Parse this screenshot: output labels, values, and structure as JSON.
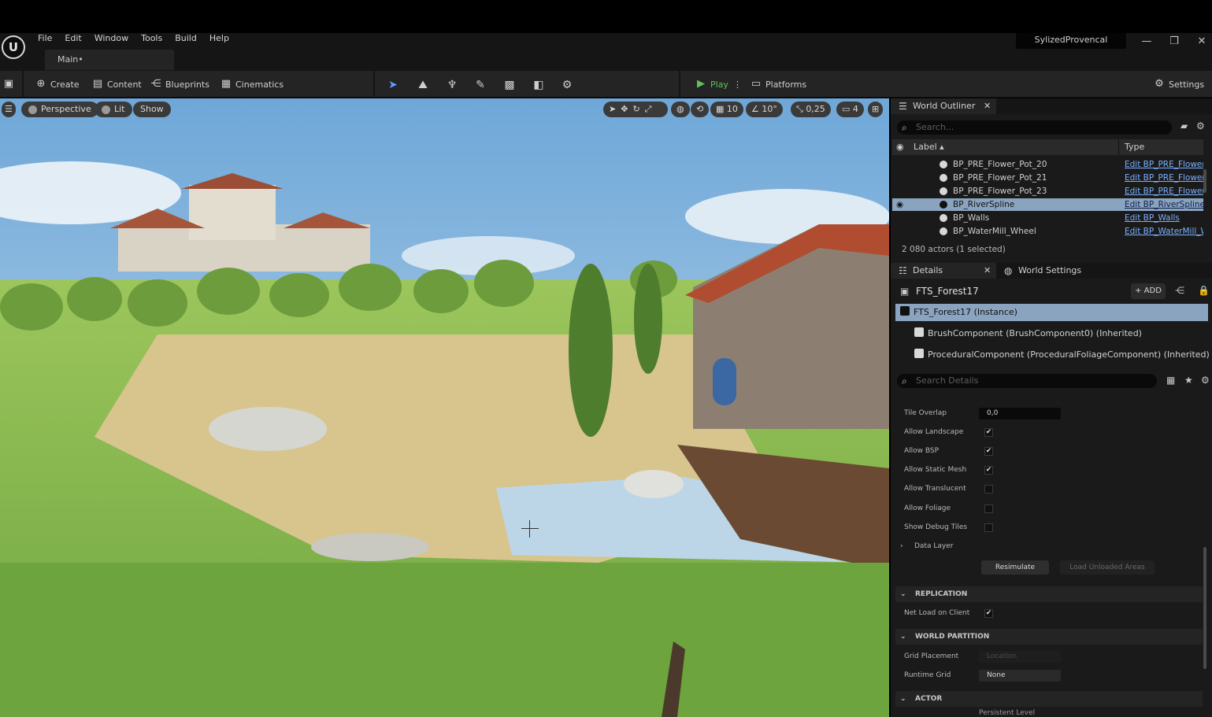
{
  "app": {
    "logo": "U",
    "menu": [
      "File",
      "Edit",
      "Window",
      "Tools",
      "Build",
      "Help"
    ],
    "document_tab": "Main•",
    "project_name": "SylizedProvencal",
    "window_controls": {
      "minimize": "—",
      "maximize": "❐",
      "close": "✕"
    }
  },
  "toolbar": {
    "create": "Create",
    "content": "Content",
    "blueprints": "Blueprints",
    "cinematics": "Cinematics",
    "play": "Play",
    "platforms": "Platforms",
    "settings": "Settings",
    "mode_icons": [
      "select-mode-icon",
      "landscape-mode-icon",
      "foliage-mode-icon",
      "paint-mode-icon",
      "fracture-mode-icon",
      "mesh-mode-icon",
      "animation-mode-icon"
    ]
  },
  "viewport": {
    "perspective": "Perspective",
    "lit": "Lit",
    "show": "Show",
    "grid_snap": "10",
    "rotation_snap": "10°",
    "scale_snap": "0,25",
    "camera_speed": "4"
  },
  "outliner": {
    "tab": "World Outliner",
    "search_placeholder": "Search...",
    "col_label": "Label ▴",
    "col_type": "Type",
    "rows": [
      {
        "label": "BP_PRE_Flower_Pot_20",
        "type": "Edit BP_PRE_Flower_"
      },
      {
        "label": "BP_PRE_Flower_Pot_21",
        "type": "Edit BP_PRE_Flower_"
      },
      {
        "label": "BP_PRE_Flower_Pot_23",
        "type": "Edit BP_PRE_Flower_"
      },
      {
        "label": "BP_RiverSpline",
        "type": "Edit BP_RiverSpline",
        "selected": true
      },
      {
        "label": "BP_Walls",
        "type": "Edit BP_Walls"
      },
      {
        "label": "BP_WaterMill_Wheel",
        "type": "Edit BP_WaterMill_W"
      }
    ],
    "actors_count": "2 080 actors (1 selected)"
  },
  "details": {
    "tab": "Details",
    "world_settings_tab": "World Settings",
    "actor_name": "FTS_Forest17",
    "add_button": "+ ADD",
    "components": [
      {
        "label": "FTS_Forest17  (Instance)",
        "selected": true
      },
      {
        "label": "BrushComponent (BrushComponent0) (Inherited)"
      },
      {
        "label": "ProceduralComponent (ProceduralFoliageComponent) (Inherited)"
      }
    ],
    "search_placeholder": "Search Details",
    "properties": {
      "tile_overlap_label": "Tile Overlap",
      "tile_overlap_value": "0,0",
      "allow_landscape": "Allow Landscape",
      "allow_bsp": "Allow BSP",
      "allow_static_mesh": "Allow Static Mesh",
      "allow_translucent": "Allow Translucent",
      "allow_foliage": "Allow Foliage",
      "show_debug_tiles": "Show Debug Tiles",
      "data_layer": "Data Layer",
      "resimulate": "Resimulate",
      "load_unloaded": "Load Unloaded Areas",
      "replication_section": "REPLICATION",
      "net_load_on_client": "Net Load on Client",
      "world_partition_section": "WORLD PARTITION",
      "grid_placement": "Grid Placement",
      "grid_placement_value": "Location",
      "runtime_grid": "Runtime Grid",
      "runtime_grid_value": "None",
      "actor_section": "ACTOR",
      "persistent_level": "Persistent Level"
    },
    "checks": {
      "landscape": "✔",
      "bsp": "✔",
      "static_mesh": "✔",
      "translucent": "",
      "foliage": "",
      "debug_tiles": "",
      "net_load": "✔"
    }
  }
}
